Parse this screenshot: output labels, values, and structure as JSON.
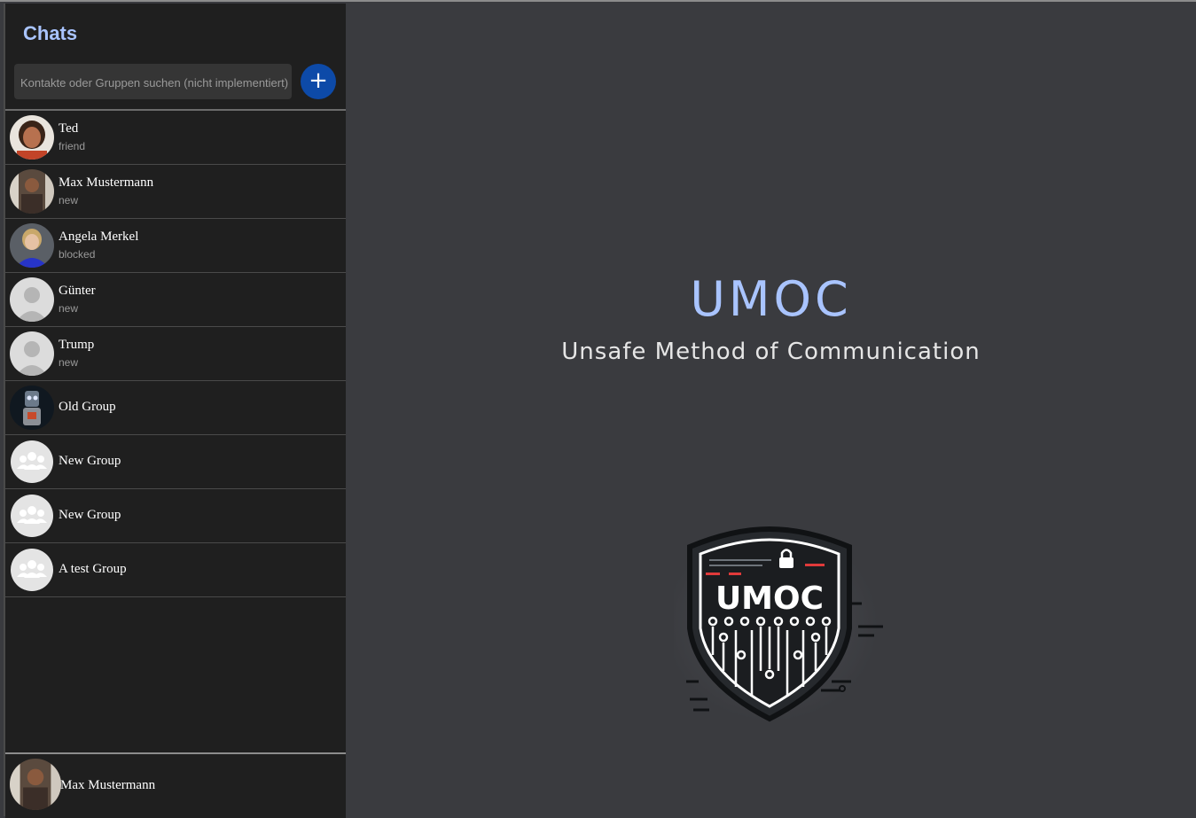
{
  "sidebar": {
    "title": "Chats",
    "search_placeholder": "Kontakte oder Gruppen suchen (nicht implementiert)",
    "add_button_label": "+",
    "chats": [
      {
        "name": "Ted",
        "status": "friend",
        "avatar": "photo-avatar"
      },
      {
        "name": "Max Mustermann",
        "status": "new",
        "avatar": "photo-avatar"
      },
      {
        "name": "Angela Merkel",
        "status": "blocked",
        "avatar": "photo-avatar"
      },
      {
        "name": "Günter",
        "status": "new",
        "avatar": "default-user-icon"
      },
      {
        "name": "Trump",
        "status": "new",
        "avatar": "default-user-icon"
      },
      {
        "name": "Old Group",
        "status": "",
        "avatar": "photo-avatar"
      },
      {
        "name": "New Group",
        "status": "",
        "avatar": "group-icon"
      },
      {
        "name": "New Group",
        "status": "",
        "avatar": "group-icon"
      },
      {
        "name": "A test Group",
        "status": "",
        "avatar": "group-icon"
      }
    ],
    "current_user": {
      "name": "Max Mustermann",
      "avatar": "photo-avatar"
    }
  },
  "main": {
    "title": "UMOC",
    "subtitle": "Unsafe Method of Communication",
    "logo": {
      "text": "UMOC",
      "icon": "shield-lock-logo"
    }
  },
  "colors": {
    "accent": "#a9c4ff",
    "button_blue": "#0d4aa8",
    "sidebar_bg": "#1f1f1f",
    "main_bg": "#3a3b3f"
  }
}
